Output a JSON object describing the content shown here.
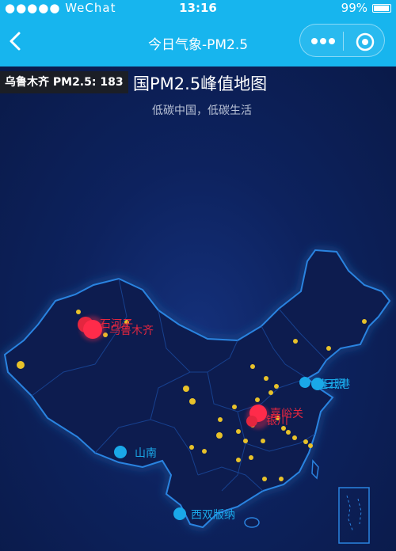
{
  "status_bar": {
    "carrier": "●●●●● WeChat",
    "time": "13:16",
    "battery": "99%"
  },
  "nav": {
    "title": "今日气象-PM2.5"
  },
  "tooltip": "乌鲁木齐 PM2.5: 183",
  "map": {
    "title": "国PM2.5峰值地图",
    "subtitle": "低碳中国，低碳生活"
  },
  "labels": {
    "urumqi_a": "石河子",
    "urumqi_b": "乌鲁木齐",
    "east_a": "连云港",
    "east_b": "日照",
    "central_a": "嘉峪关",
    "central_b": "银川",
    "shannan": "山南",
    "xishuangbanna": "西双版纳"
  },
  "colors": {
    "accent": "#17b5ee",
    "high": "#ff2b4a",
    "mid": "#e8c22a",
    "low": "#1aa8e8"
  }
}
